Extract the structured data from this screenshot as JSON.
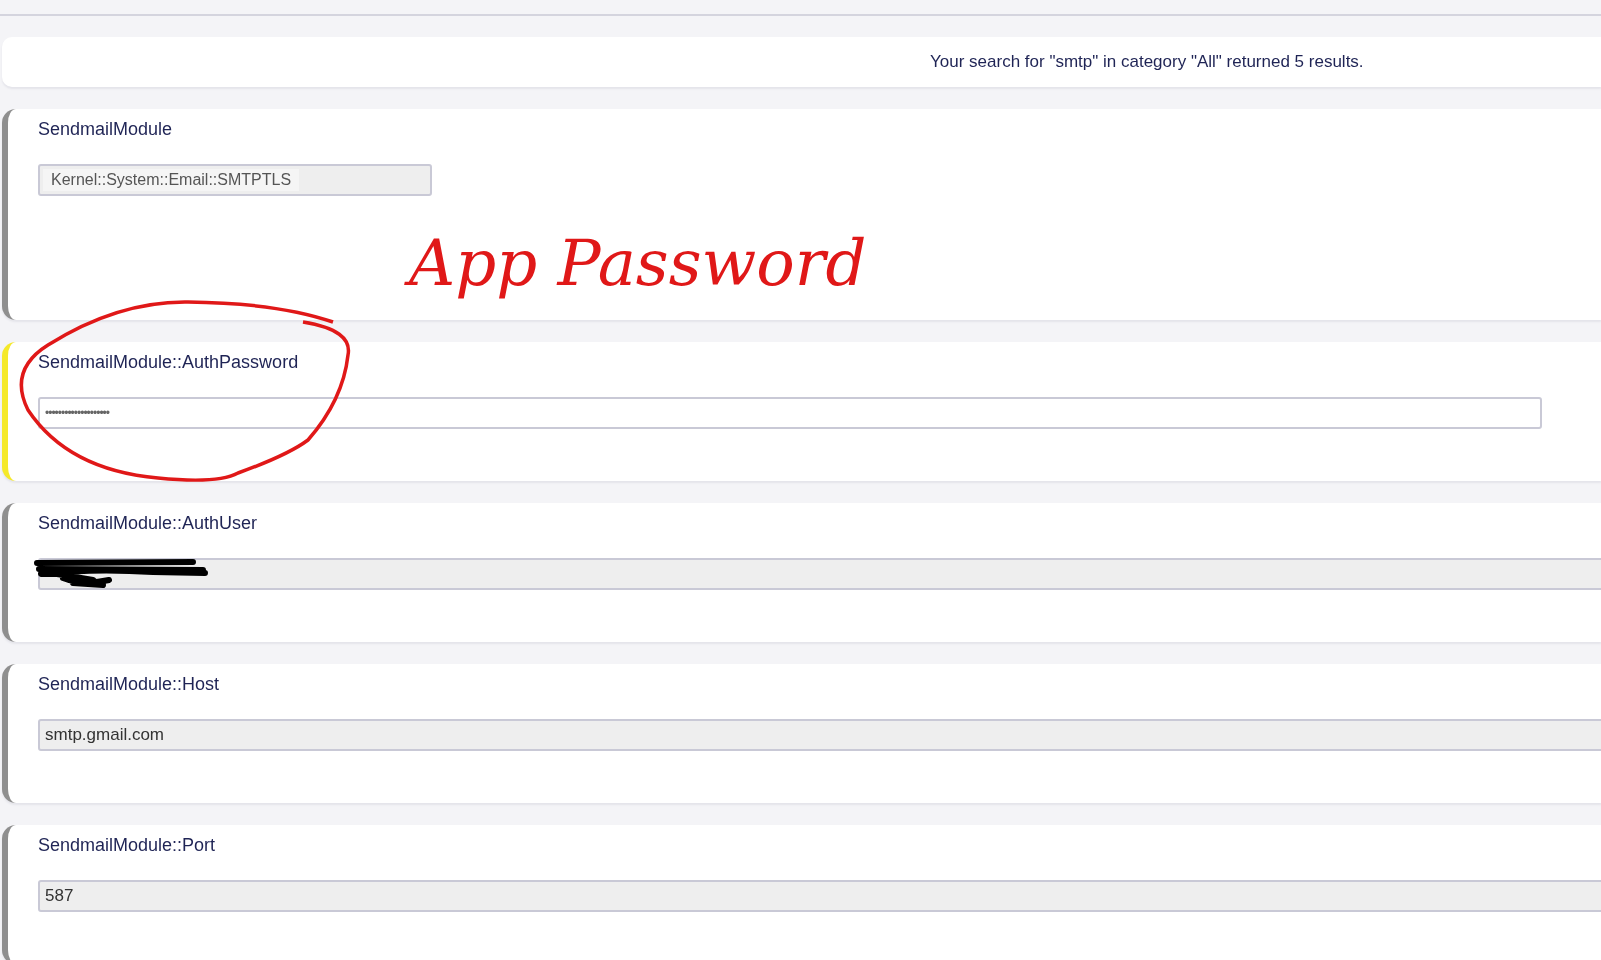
{
  "search_summary": "Your search for \"smtp\" in category \"All\" returned 5 results.",
  "settings": [
    {
      "name": "SendmailModule",
      "kind": "select",
      "value": "Kernel::System::Email::SMTPTLS",
      "modified": false,
      "editable": false,
      "redacted": false
    },
    {
      "name": "SendmailModule::AuthPassword",
      "kind": "password",
      "value": "••••••••••••••••••••",
      "modified": true,
      "editable": true,
      "redacted": false
    },
    {
      "name": "SendmailModule::AuthUser",
      "kind": "text",
      "modified": false,
      "editable": false,
      "redacted": true
    },
    {
      "name": "SendmailModule::Host",
      "kind": "text",
      "value": "smtp.gmail.com",
      "modified": false,
      "editable": false,
      "redacted": false
    },
    {
      "name": "SendmailModule::Port",
      "kind": "text",
      "value": "587",
      "modified": false,
      "editable": false,
      "redacted": false
    }
  ],
  "annotation": {
    "text": "App Password"
  }
}
